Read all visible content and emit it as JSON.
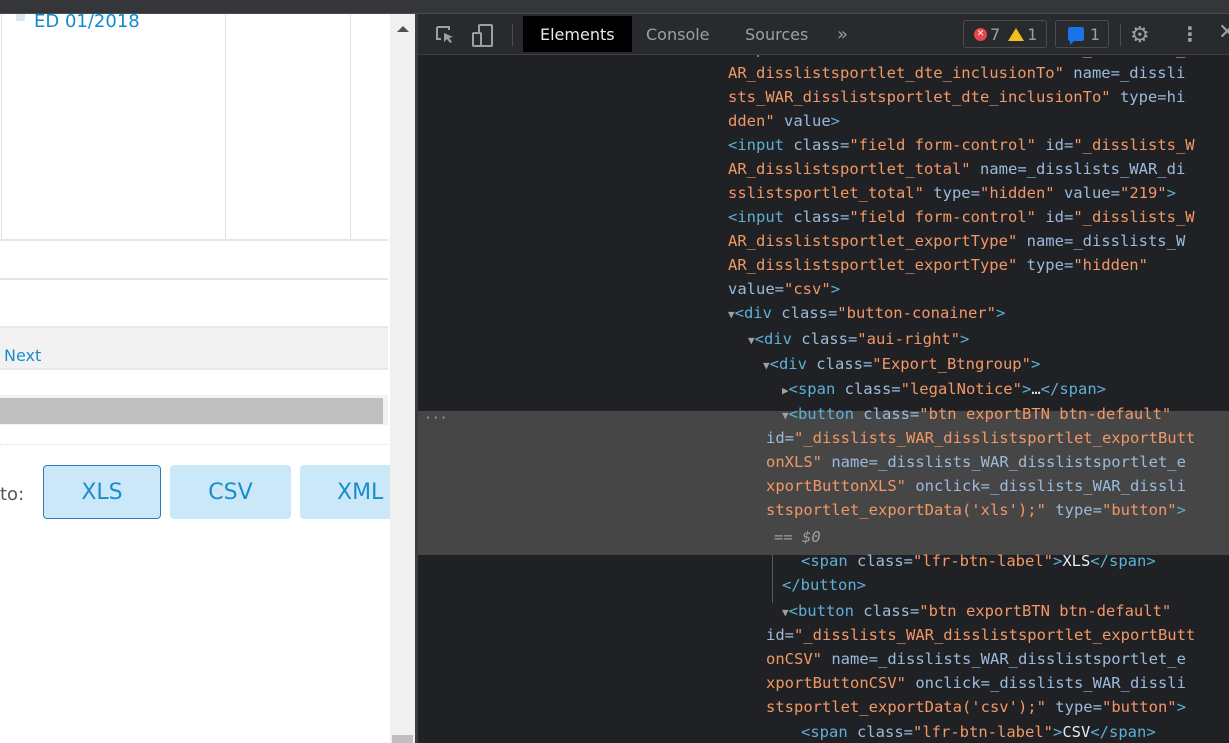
{
  "webpage": {
    "list_item_link": "ED 01/2018",
    "pager_next": "Next",
    "export_label": "to:",
    "export_buttons": [
      {
        "label": "XLS",
        "focused": true
      },
      {
        "label": "CSV",
        "focused": false
      },
      {
        "label": "XML",
        "focused": false
      }
    ]
  },
  "devtools": {
    "tabs": [
      {
        "label": "Elements",
        "active": true
      },
      {
        "label": "Console",
        "active": false
      },
      {
        "label": "Sources",
        "active": false
      }
    ],
    "more_tabs": "»",
    "error_count": "7",
    "warning_count": "1",
    "message_count": "1",
    "selected_marker": "== $0",
    "row_menu": "···",
    "lines": [
      "<input class=\"field form-control\" id=\"_disslists_W",
      "AR_disslistsportlet_dte_inclusionTo\" name=\"_dissli",
      "sts_WAR_disslistsportlet_dte_inclusionTo\" type=\"hi",
      "dden\" value>",
      "<input class=\"field form-control\" id=\"_disslists_W",
      "AR_disslistsportlet_total\" name=\"_disslists_WAR_di",
      "sslistsportlet_total\" type=\"hidden\" value=\"219\">",
      "<input class=\"field form-control\" id=\"_disslists_W",
      "AR_disslistsportlet_exportType\" name=\"_disslists_W",
      "AR_disslistsportlet_exportType\" type=\"hidden\"",
      "value=\"csv\">",
      "<div class=\"button-conainer\">",
      "<div class=\"aui-right\">",
      "<div class=\"Export_Btngroup\">",
      "<span class=\"legalNotice\">…</span>",
      "<button class=\"btn exportBTN btn-default\"",
      "id=\"_disslists_WAR_disslistsportlet_exportButt",
      "onXLS\" name=\"_disslists_WAR_disslistsportlet_e",
      "xportButtonXLS\" onclick=\"_disslists_WAR_dissli",
      "stsportlet_exportData('xls');\" type=\"button\">",
      "<span class=\"lfr-btn-label\">XLS</span>",
      "</button>",
      "<button class=\"btn exportBTN btn-default\"",
      "id=\"_disslists_WAR_disslistsportlet_exportButt",
      "onCSV\" name=\"_disslists_WAR_disslistsportlet_e",
      "xportButtonCSV\" onclick=\"_disslists_WAR_dissli",
      "stsportlet_exportData('csv');\" type=\"button\">",
      "<span class=\"lfr-btn-label\">CSV</span>"
    ]
  }
}
